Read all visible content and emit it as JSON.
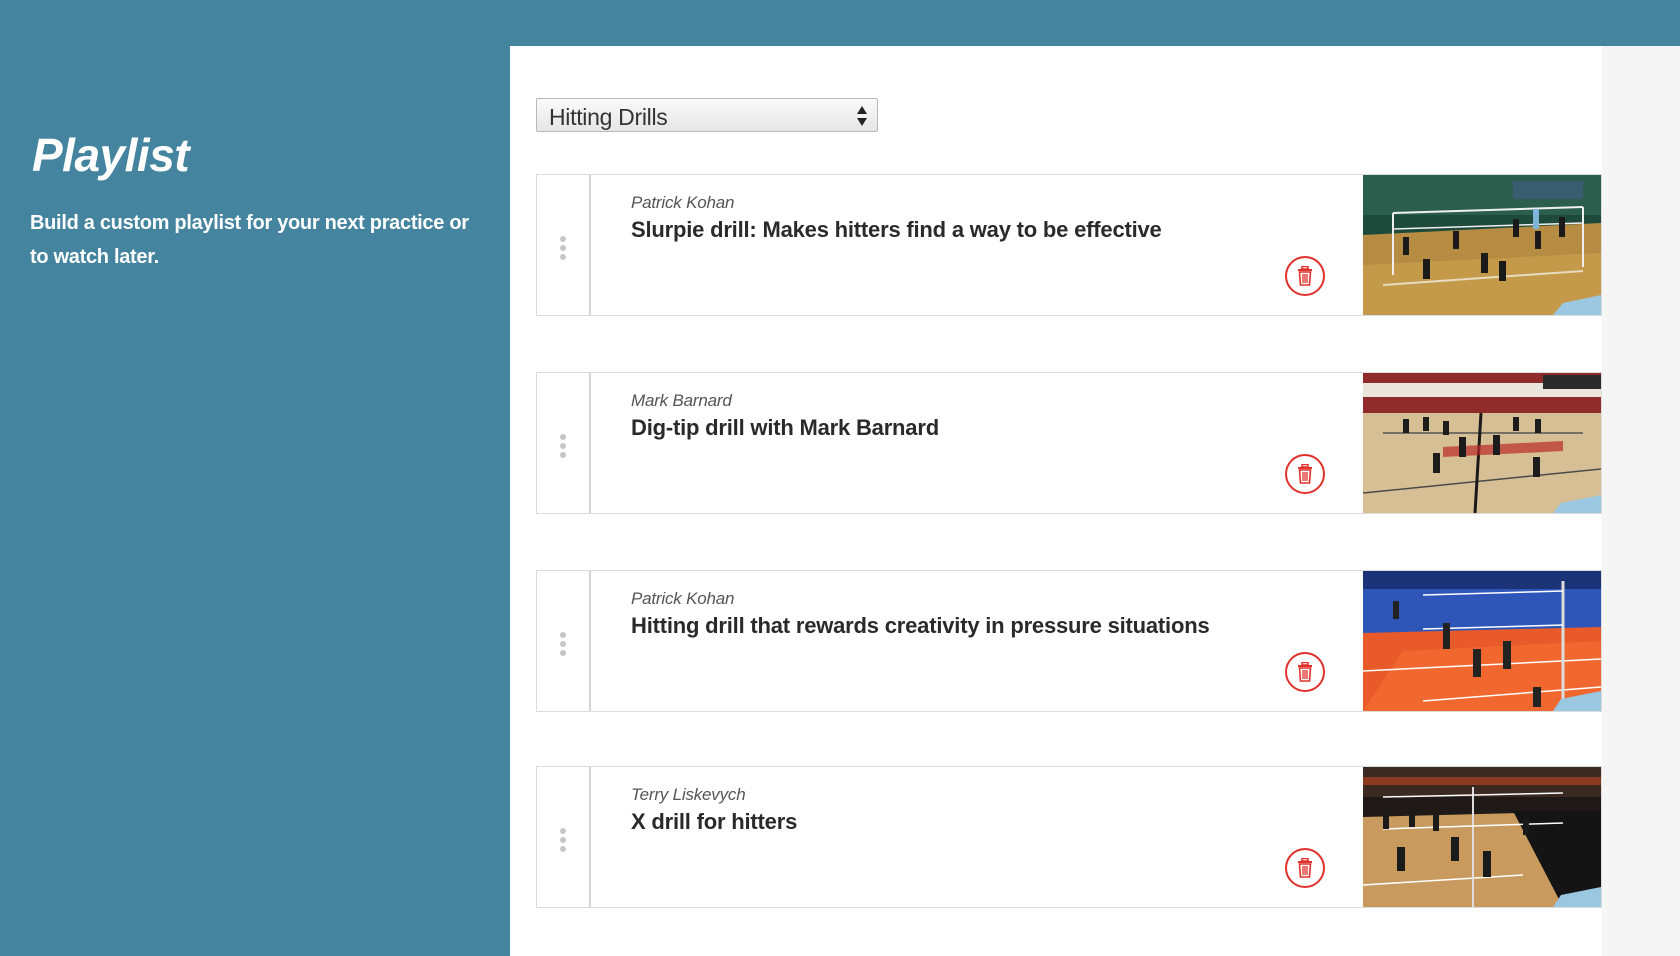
{
  "sidebar": {
    "title": "Playlist",
    "description": "Build a custom playlist for your next practice or to watch later."
  },
  "playlist_select": {
    "selected": "Hitting Drills"
  },
  "items": [
    {
      "author": "Patrick Kohan",
      "title": "Slurpie drill: Makes hitters find a way to be effective"
    },
    {
      "author": "Mark Barnard",
      "title": "Dig-tip drill with Mark Barnard"
    },
    {
      "author": "Patrick Kohan",
      "title": "Hitting drill that rewards creativity in pressure situations"
    },
    {
      "author": "Terry Liskevych",
      "title": "X drill for hitters"
    }
  ],
  "icons": {
    "drag": "drag-handle-icon",
    "delete": "trash-icon"
  },
  "colors": {
    "background": "#44849f",
    "delete_accent": "#e0312b",
    "text": "#2a2a2a"
  }
}
